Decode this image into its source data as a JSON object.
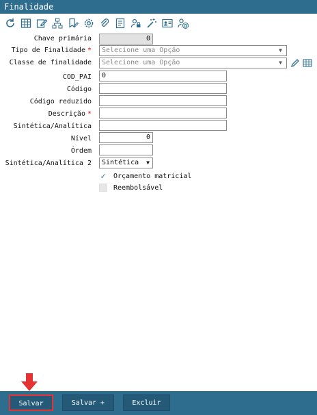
{
  "window": {
    "title": "Finalidade"
  },
  "toolbar": {
    "icons": [
      "refresh-icon",
      "grid-icon",
      "edit-icon",
      "hierarchy-icon",
      "settings-icon",
      "attach-icon",
      "report-icon",
      "user-lock-icon",
      "magic-wand-icon",
      "contact-card-icon",
      "user-email-icon"
    ]
  },
  "form": {
    "chave_primaria": {
      "label": "Chave primária",
      "value": "0"
    },
    "tipo_finalidade": {
      "label": "Tipo de Finalidade",
      "placeholder": "Selecione uma Opção",
      "required": "*"
    },
    "classe_finalidade": {
      "label": "Classe de finalidade",
      "placeholder": "Selecione uma Opção"
    },
    "cod_pai": {
      "label": "COD_PAI",
      "value": "0"
    },
    "codigo": {
      "label": "Código",
      "value": ""
    },
    "codigo_reduzido": {
      "label": "Código reduzido",
      "value": ""
    },
    "descricao": {
      "label": "Descrição",
      "value": "",
      "required": "*"
    },
    "sintetica_analitica": {
      "label": "Sintética/Analítica",
      "value": ""
    },
    "nivel": {
      "label": "Nível",
      "value": "0"
    },
    "ordem": {
      "label": "Órdem",
      "value": ""
    },
    "sintetica_analitica_2": {
      "label": "Sintética/Analítica 2",
      "value": "Sintética"
    },
    "orcamento_matricial": {
      "label": "Orçamento matricial",
      "checked": true
    },
    "reembolsavel": {
      "label": "Reembolsável",
      "checked": false
    }
  },
  "footer": {
    "salvar": "Salvar",
    "salvar_plus": "Salvar +",
    "excluir": "Excluir"
  },
  "colors": {
    "header": "#2f6d8e",
    "button": "#245a78",
    "highlight": "#e53232"
  }
}
